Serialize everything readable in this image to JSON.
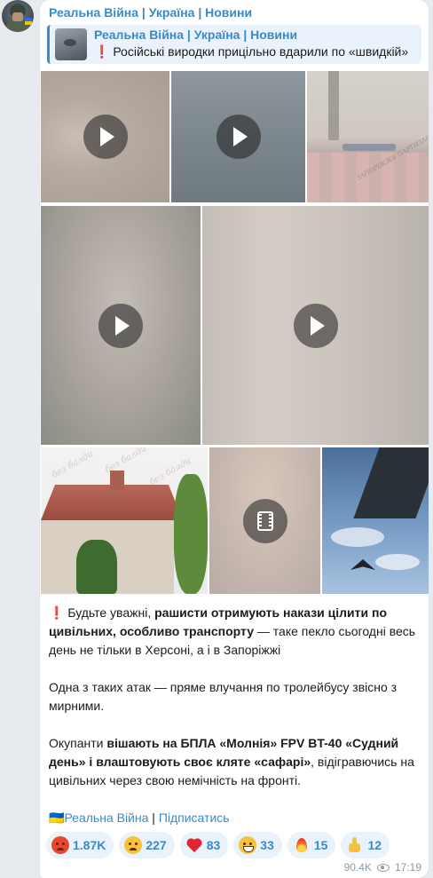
{
  "channel": {
    "name": "Реальна Війна | Україна | Новини"
  },
  "reply": {
    "title": "Реальна Війна | Україна | Новини",
    "excl": "❗",
    "text": "Російські виродки прицільно вдарили по «швидкій»"
  },
  "media_watermarks": {
    "tile3": "ЗАПОРІЖЖЯ ПАРТИЗАНИ",
    "tile6": "без балди"
  },
  "message": {
    "p1": {
      "excl": "❗",
      "t1": " Будьте уважні, ",
      "b1": "рашисти отримують накази цілити по цивільних, особливо транспорту",
      "t2": " — таке пекло сьогодні весь день не тільки в Херсоні, а і в Запоріжжі"
    },
    "p2": "Одна з таких атак — пряме влучання по тролейбусу звісно з мирними.",
    "p3": {
      "t1": "Окупанти ",
      "b1": "вішають на БПЛА «Молнія» FPV BT-40 «Судний день» і влаштовують своє кляте «сафарі»",
      "t2": ", відігравючись на цивільних через свою немічність на фронті."
    },
    "footer": {
      "flag": "🇺🇦",
      "channel_link": "Реальна Війна",
      "separator": " | ",
      "subscribe_link": "Підписатись"
    }
  },
  "reactions": [
    {
      "icon": "angry-face-icon",
      "count": "1.87K"
    },
    {
      "icon": "sad-face-icon",
      "count": "227"
    },
    {
      "icon": "heart-icon",
      "count": "83"
    },
    {
      "icon": "grinning-face-icon",
      "count": "33"
    },
    {
      "icon": "fire-icon",
      "count": "15"
    },
    {
      "icon": "thumbs-up-icon",
      "count": "12"
    }
  ],
  "meta": {
    "views": "90.4K",
    "time": "17:19"
  },
  "colors": {
    "accent": "#3a8ac9",
    "background": "#e7ebf0",
    "bubble": "#ffffff",
    "alert": "#e02424"
  }
}
